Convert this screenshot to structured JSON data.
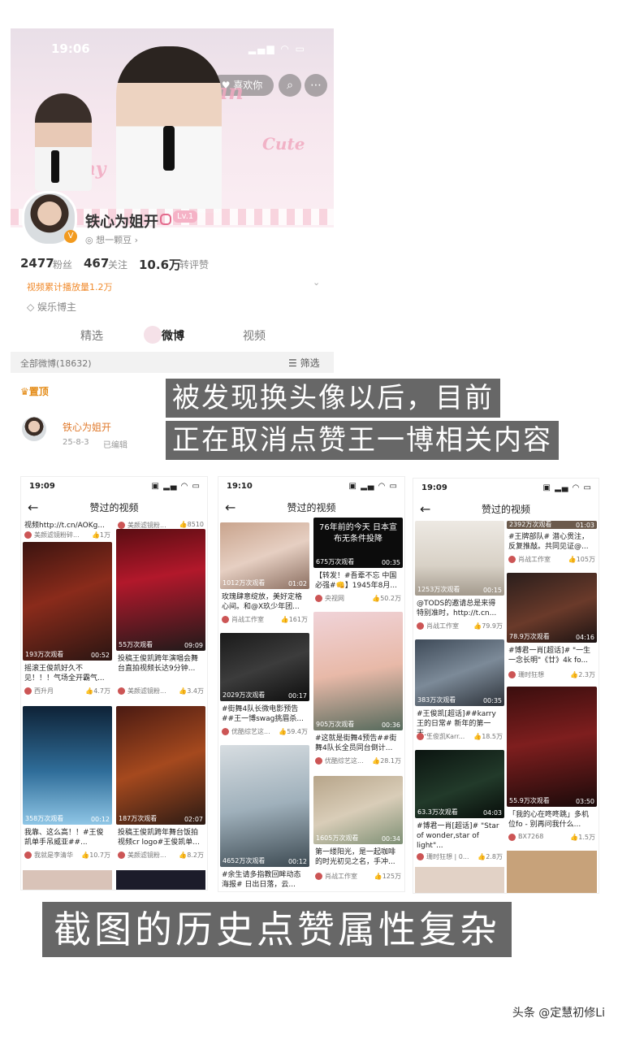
{
  "profile": {
    "status_time": "19:06",
    "like_pill": "喜欢你",
    "nickname": "铁心为姐开",
    "level_badge": "Lv.1",
    "subtitle": "想一颗豆",
    "stats": [
      {
        "num": "2477",
        "label": "粉丝"
      },
      {
        "num": "467",
        "label": "关注"
      },
      {
        "num": "10.6万",
        "label": "转评赞"
      }
    ],
    "play_note": "视频累计播放量1.2万",
    "category": "娱乐博主",
    "tabs": [
      "精选",
      "微博",
      "视频"
    ],
    "list_title": "全部微博(18632)",
    "filter": "筛选",
    "pinned": "置顶",
    "post_author": "铁心为姐开",
    "post_date": "25-8-3",
    "post_edited": "已编辑",
    "deco_words": [
      "Bunny",
      "Cute",
      "Xiao Zhan"
    ]
  },
  "captions": {
    "line1": "被发现换头像以后，目前",
    "line2": "正在取消点赞王一博相关内容",
    "bottom": "截图的历史点赞属性复杂"
  },
  "watermark": "头条 @定慧初修Li",
  "phones": [
    {
      "time": "19:09",
      "header": "赞过的视频",
      "cards": [
        {
          "views": "",
          "dur": "",
          "title": "视频http://t.cn/AOKg...",
          "author": "美颜滤镜粉碎...",
          "likes": "1万"
        },
        {
          "views": "",
          "dur": "",
          "title": "",
          "author": "美颜滤镜粉...",
          "likes": "8510"
        },
        {
          "views": "193万次观看",
          "dur": "00:52",
          "title": "摇滚王俊凯好久不见！！！气场全开霸气...",
          "author": "西升月",
          "likes": "4.7万"
        },
        {
          "views": "55万次观看",
          "dur": "09:09",
          "title": "投稿王俊凯跨年演唱会舞台直拍视频长达9分钟...",
          "author": "美颜滤镜粉...",
          "likes": "3.4万"
        },
        {
          "views": "358万次观看",
          "dur": "00:12",
          "title": "我靠、这么高！！#王俊凯单手吊威亚##...",
          "author": "我就是李清华",
          "likes": "10.7万"
        },
        {
          "views": "187万次观看",
          "dur": "02:07",
          "title": "投稿王俊凯跨年舞台饭拍视频cr logo#王俊凯单...",
          "author": "美颜滤镜粉...",
          "likes": "8.2万"
        }
      ]
    },
    {
      "time": "19:10",
      "header": "赞过的视频",
      "news_text": "76年前的今天 日本宣布无条件投降",
      "cards": [
        {
          "views": "1012万次观看",
          "dur": "01:02",
          "title": "玫瑰肆意绽放，美好定格心间。和@X玖少年团...",
          "author": "肖战工作室",
          "likes": "161万"
        },
        {
          "views": "675万次观看",
          "dur": "00:35",
          "title": "【转发！#吾辈不忘 中国必强#👊】1945年8月...",
          "author": "央视网",
          "likes": "50.2万"
        },
        {
          "views": "2029万次观看",
          "dur": "00:17",
          "title": "#街舞4队长微电影预告##王一博swag挑眉杀...",
          "author": "优酷综艺这...",
          "likes": "59.4万"
        },
        {
          "views": "905万次观看",
          "dur": "00:36",
          "title": "#这就是街舞4预告##街舞4队长全员同台倒计...",
          "author": "优酷综艺这...",
          "likes": "28.1万"
        },
        {
          "views": "4652万次观看",
          "dur": "00:12",
          "title": "#余生请多指教回眸动态海报# 日出日落，云...",
          "author": "",
          "likes": ""
        },
        {
          "views": "1605万次观看",
          "dur": "00:34",
          "title": "第一缕阳光，是一起咖啡的时光初见之名，手冲...",
          "author": "肖战工作室",
          "likes": "125万"
        }
      ]
    },
    {
      "time": "19:09",
      "header": "赞过的视频",
      "cards": [
        {
          "views": "2392万次观看",
          "dur": "01:03",
          "title": "",
          "author": "",
          "likes": ""
        },
        {
          "views": "",
          "dur": "",
          "title": "#王牌部队# 潜心贯注，反复推敲。共同见证@...",
          "author": "肖战工作室",
          "likes": "105万"
        },
        {
          "views": "1253万次观看",
          "dur": "00:15",
          "title": "@TODS的邀请总是来得特别准时，http://t.cn...",
          "author": "肖战工作室",
          "likes": "79.9万"
        },
        {
          "views": "78.9万次观看",
          "dur": "04:16",
          "title": "#博君一肖[超话]# \"一生一念长明\"《廿》4k fo...",
          "author": "珊时狂想",
          "likes": "2.3万"
        },
        {
          "views": "383万次观看",
          "dur": "00:35",
          "title": "#王俊凯[超话]##karry王的日常# 新年的第一天...",
          "author": "王俊凯Karr...",
          "likes": "18.5万"
        },
        {
          "views": "55.9万次观看",
          "dur": "03:50",
          "title": "「我的心在咚咚跳」多机位fo - 别再问我什么...",
          "author": "BX7268",
          "likes": "1.5万"
        },
        {
          "views": "63.3万次观看",
          "dur": "04:03",
          "title": "#博君一肖[超话]# \"Star of wonder,star of light\"...",
          "author": "珊时狂想 | 0...",
          "likes": "2.8万"
        }
      ]
    }
  ]
}
